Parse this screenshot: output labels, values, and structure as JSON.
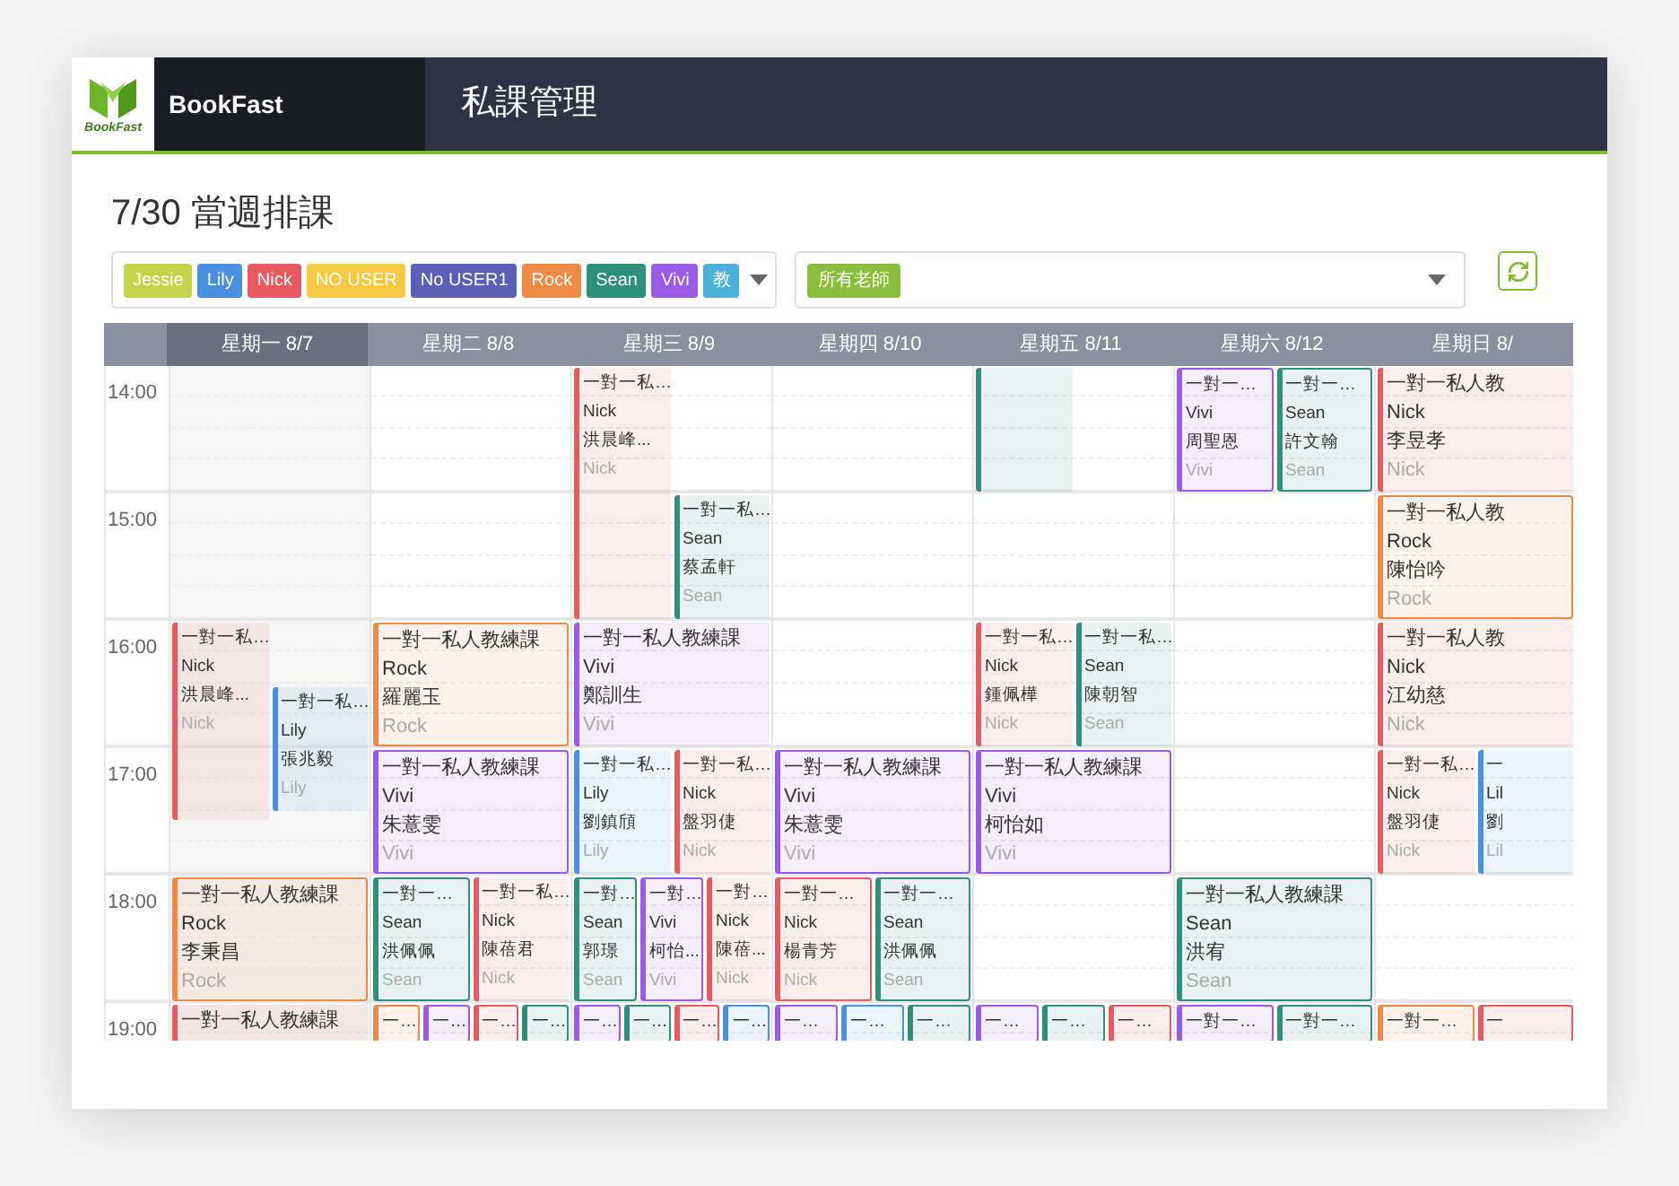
{
  "brand": {
    "logo_text": "BookFast",
    "name": "BookFast"
  },
  "page_title": "私課管理",
  "heading": "7/30 當週排課",
  "teacher_tags": [
    {
      "label": "Jessie",
      "color": "#c3d64b"
    },
    {
      "label": "Lily",
      "color": "#4a90e2"
    },
    {
      "label": "Nick",
      "color": "#e75a5f"
    },
    {
      "label": "NO USER",
      "color": "#f7c843"
    },
    {
      "label": "No USER1",
      "color": "#5a5fb8"
    },
    {
      "label": "Rock",
      "color": "#ef8a45"
    },
    {
      "label": "Sean",
      "color": "#2f8f7d"
    },
    {
      "label": "Vivi",
      "color": "#9a5ce6"
    },
    {
      "label": "教",
      "color": "#4ab2d8"
    }
  ],
  "teacher_filter": {
    "label": "所有老師",
    "color": "#8bbd3c"
  },
  "days": [
    {
      "label": "星期一 8/7",
      "selected": true
    },
    {
      "label": "星期二 8/8",
      "selected": false
    },
    {
      "label": "星期三 8/9",
      "selected": false
    },
    {
      "label": "星期四 8/10",
      "selected": false
    },
    {
      "label": "星期五 8/11",
      "selected": false
    },
    {
      "label": "星期六 8/12",
      "selected": false
    },
    {
      "label": "星期日 8/",
      "selected": false
    }
  ],
  "rows": [
    {
      "hour": "14:00",
      "cells": [
        {},
        {},
        {
          "events": [
            {
              "kind": "double",
              "color": "#e75a5f",
              "outlined": false,
              "title": "一對一私…",
              "teacher": "Nick",
              "student": "洪晨峰...",
              "footer": "Nick"
            },
            {
              "kind": "next",
              "color": "#2f8f7d",
              "outlined": false,
              "title": "一對一私…",
              "teacher": "Sean",
              "student": "蔡孟軒",
              "footer": "Sean"
            }
          ]
        },
        {},
        {
          "events": [
            {
              "kind": "carried",
              "color": "#2f8f7d",
              "outlined": false
            }
          ]
        },
        {
          "events": [
            {
              "kind": "hour",
              "color": "#9a5ce6",
              "outlined": true,
              "title": "一對一…",
              "teacher": "Vivi",
              "student": "周聖恩",
              "footer": "Vivi"
            },
            {
              "kind": "hour",
              "color": "#2f8f7d",
              "outlined": true,
              "title": "一對一…",
              "teacher": "Sean",
              "student": "許文翰",
              "footer": "Sean"
            }
          ]
        },
        {
          "events": [
            {
              "kind": "hour",
              "color": "#e75a5f",
              "outlined": false,
              "title": "一對一私人教",
              "teacher": "Nick",
              "student": "李昱孝",
              "footer": "Nick"
            }
          ]
        }
      ]
    },
    {
      "hour": "15:00",
      "cells": [
        {},
        {},
        {},
        {},
        {},
        {},
        {
          "events": [
            {
              "kind": "hour",
              "color": "#ef8a45",
              "outlined": true,
              "title": "一對一私人教",
              "teacher": "Rock",
              "student": "陳怡吟",
              "footer": "Rock"
            }
          ]
        }
      ]
    },
    {
      "hour": "16:00",
      "cells": [
        {
          "events": [
            {
              "kind": "long",
              "color": "#e75a5f",
              "outlined": false,
              "title": "一對一私…",
              "teacher": "Nick",
              "student": "洪晨峰...",
              "footer": "Nick"
            },
            {
              "kind": "late",
              "color": "#4a90e2",
              "outlined": false,
              "title": "一對一私…",
              "teacher": "Lily",
              "student": "張兆毅",
              "footer": "Lily"
            }
          ]
        },
        {
          "events": [
            {
              "kind": "hour",
              "color": "#ef8a45",
              "outlined": true,
              "title": "一對一私人教練課",
              "teacher": "Rock",
              "student": "羅麗玉",
              "footer": "Rock"
            }
          ]
        },
        {
          "events": [
            {
              "kind": "hour",
              "color": "#9a5ce6",
              "outlined": false,
              "title": "一對一私人教練課",
              "teacher": "Vivi",
              "student": "鄭訓生",
              "footer": "Vivi"
            }
          ]
        },
        {},
        {
          "events": [
            {
              "kind": "hour",
              "color": "#e75a5f",
              "outlined": false,
              "title": "一對一私…",
              "teacher": "Nick",
              "student": "鍾佩樺",
              "footer": "Nick"
            },
            {
              "kind": "hour",
              "color": "#2f8f7d",
              "outlined": false,
              "title": "一對一私…",
              "teacher": "Sean",
              "student": "陳朝智",
              "footer": "Sean"
            }
          ]
        },
        {},
        {
          "events": [
            {
              "kind": "hour",
              "color": "#e75a5f",
              "outlined": false,
              "title": "一對一私人教",
              "teacher": "Nick",
              "student": "江幼慈",
              "footer": "Nick"
            }
          ]
        }
      ]
    },
    {
      "hour": "17:00",
      "cells": [
        {},
        {
          "events": [
            {
              "kind": "hour",
              "color": "#9a5ce6",
              "outlined": true,
              "title": "一對一私人教練課",
              "teacher": "Vivi",
              "student": "朱薏雯",
              "footer": "Vivi"
            }
          ]
        },
        {
          "events": [
            {
              "kind": "hour",
              "color": "#4a90e2",
              "outlined": false,
              "title": "一對一私…",
              "teacher": "Lily",
              "student": "劉鎮頎",
              "footer": "Lily"
            },
            {
              "kind": "hour",
              "color": "#e75a5f",
              "outlined": false,
              "title": "一對一私…",
              "teacher": "Nick",
              "student": "盤羽倢",
              "footer": "Nick"
            }
          ]
        },
        {
          "events": [
            {
              "kind": "hour",
              "color": "#9a5ce6",
              "outlined": true,
              "title": "一對一私人教練課",
              "teacher": "Vivi",
              "student": "朱薏雯",
              "footer": "Vivi"
            }
          ]
        },
        {
          "events": [
            {
              "kind": "hour",
              "color": "#9a5ce6",
              "outlined": true,
              "title": "一對一私人教練課",
              "teacher": "Vivi",
              "student": "柯怡如",
              "footer": "Vivi"
            }
          ]
        },
        {},
        {
          "events": [
            {
              "kind": "hour",
              "color": "#e75a5f",
              "outlined": false,
              "title": "一對一私…",
              "teacher": "Nick",
              "student": "盤羽倢",
              "footer": "Nick"
            },
            {
              "kind": "hour",
              "color": "#4a90e2",
              "outlined": false,
              "title": "一",
              "teacher": "Lil",
              "student": "劉",
              "footer": "Lil"
            }
          ]
        }
      ]
    },
    {
      "hour": "18:00",
      "cells": [
        {
          "events": [
            {
              "kind": "hour",
              "color": "#ef8a45",
              "outlined": true,
              "title": "一對一私人教練課",
              "teacher": "Rock",
              "student": "李秉昌",
              "footer": "Rock"
            }
          ]
        },
        {
          "events": [
            {
              "kind": "hour",
              "color": "#2f8f7d",
              "outlined": true,
              "title": "一對一…",
              "teacher": "Sean",
              "student": "洪佩佩",
              "footer": "Sean"
            },
            {
              "kind": "hour",
              "color": "#e75a5f",
              "outlined": false,
              "title": "一對一私…",
              "teacher": "Nick",
              "student": "陳蓓君",
              "footer": "Nick"
            }
          ]
        },
        {
          "events": [
            {
              "kind": "hour",
              "color": "#2f8f7d",
              "outlined": true,
              "title": "一對…",
              "teacher": "Sean",
              "student": "郭璟",
              "footer": "Sean"
            },
            {
              "kind": "hour",
              "color": "#9a5ce6",
              "outlined": true,
              "title": "一對…",
              "teacher": "Vivi",
              "student": "柯怡...",
              "footer": "Vivi"
            },
            {
              "kind": "hour",
              "color": "#e75a5f",
              "outlined": false,
              "title": "一對…",
              "teacher": "Nick",
              "student": "陳蓓...",
              "footer": "Nick"
            }
          ]
        },
        {
          "events": [
            {
              "kind": "hour",
              "color": "#e75a5f",
              "outlined": true,
              "title": "一對一…",
              "teacher": "Nick",
              "student": "楊青芳",
              "footer": "Nick"
            },
            {
              "kind": "hour",
              "color": "#2f8f7d",
              "outlined": true,
              "title": "一對一…",
              "teacher": "Sean",
              "student": "洪佩佩",
              "footer": "Sean"
            }
          ]
        },
        {},
        {
          "events": [
            {
              "kind": "hour",
              "color": "#2f8f7d",
              "outlined": true,
              "title": "一對一私人教練課",
              "teacher": "Sean",
              "student": "洪宥",
              "footer": "Sean"
            }
          ]
        },
        {}
      ]
    },
    {
      "hour": "19:00",
      "cells": [
        {
          "events": [
            {
              "kind": "hour",
              "color": "#e75a5f",
              "outlined": false,
              "title": "一對一私人教練課"
            }
          ]
        },
        {
          "events": [
            {
              "kind": "hour",
              "color": "#ef8a45",
              "outlined": true,
              "title": "一…"
            },
            {
              "kind": "hour",
              "color": "#9a5ce6",
              "outlined": true,
              "title": "一…"
            },
            {
              "kind": "hour",
              "color": "#e75a5f",
              "outlined": true,
              "title": "一…"
            },
            {
              "kind": "hour",
              "color": "#2f8f7d",
              "outlined": true,
              "title": "一…"
            }
          ]
        },
        {
          "events": [
            {
              "kind": "hour",
              "color": "#9a5ce6",
              "outlined": true,
              "title": "一…"
            },
            {
              "kind": "hour",
              "color": "#2f8f7d",
              "outlined": true,
              "title": "一…"
            },
            {
              "kind": "hour",
              "color": "#e75a5f",
              "outlined": true,
              "title": "一…"
            },
            {
              "kind": "hour",
              "color": "#4a90e2",
              "outlined": true,
              "title": "一…"
            }
          ]
        },
        {
          "events": [
            {
              "kind": "hour",
              "color": "#9a5ce6",
              "outlined": true,
              "title": "一…"
            },
            {
              "kind": "hour",
              "color": "#4a90e2",
              "outlined": true,
              "title": "一…"
            },
            {
              "kind": "hour",
              "color": "#2f8f7d",
              "outlined": true,
              "title": "一…"
            }
          ]
        },
        {
          "events": [
            {
              "kind": "hour",
              "color": "#9a5ce6",
              "outlined": true,
              "title": "一…"
            },
            {
              "kind": "hour",
              "color": "#2f8f7d",
              "outlined": true,
              "title": "一…"
            },
            {
              "kind": "hour",
              "color": "#e75a5f",
              "outlined": true,
              "title": "一…"
            }
          ]
        },
        {
          "events": [
            {
              "kind": "hour",
              "color": "#9a5ce6",
              "outlined": true,
              "title": "一對一…"
            },
            {
              "kind": "hour",
              "color": "#2f8f7d",
              "outlined": true,
              "title": "一對一…"
            }
          ]
        },
        {
          "events": [
            {
              "kind": "hour",
              "color": "#ef8a45",
              "outlined": true,
              "title": "一對一…"
            },
            {
              "kind": "hour",
              "color": "#e75a5f",
              "outlined": true,
              "title": "一"
            }
          ]
        }
      ]
    }
  ]
}
